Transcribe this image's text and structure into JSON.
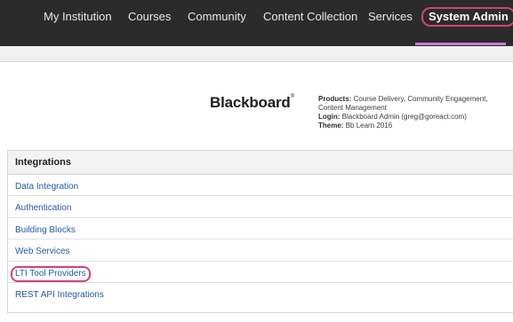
{
  "topnav": {
    "items": [
      {
        "label": "My Institution"
      },
      {
        "label": "Courses"
      },
      {
        "label": "Community"
      },
      {
        "label": "Content Collection"
      },
      {
        "label": "Services"
      },
      {
        "label": "System Admin",
        "active": true
      }
    ],
    "highlight_color": "#d0427a",
    "underline_color": "#c77ad6"
  },
  "brand": {
    "name": "Blackboard",
    "mark": "®"
  },
  "info": {
    "products_label": "Products:",
    "products_value": "Course Delivery, Community Engagement, Content Management",
    "login_label": "Login:",
    "login_value": "Blackboard Admin (greg@goreact.com)",
    "theme_label": "Theme:",
    "theme_value": "Bb Learn 2016"
  },
  "integrations": {
    "title": "Integrations",
    "links": [
      {
        "label": "Data Integration"
      },
      {
        "label": "Authentication"
      },
      {
        "label": "Building Blocks"
      },
      {
        "label": "Web Services"
      },
      {
        "label": "LTI Tool Providers",
        "highlighted": true
      },
      {
        "label": "REST API Integrations"
      }
    ]
  }
}
